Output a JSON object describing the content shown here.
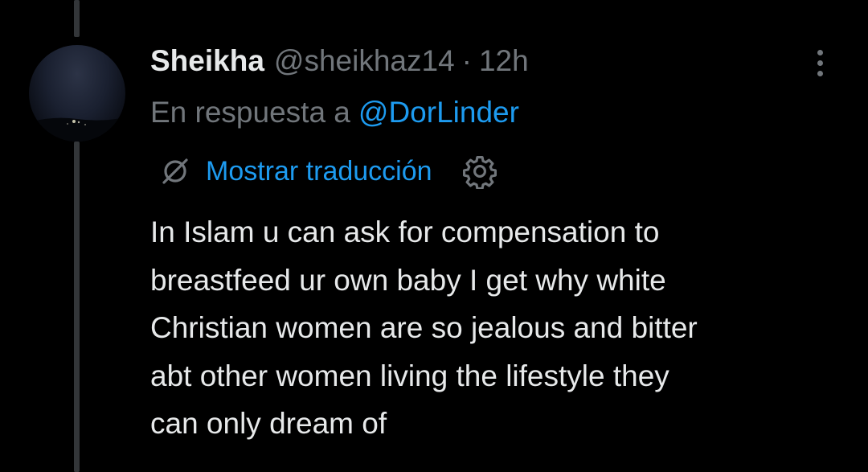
{
  "tweet": {
    "author_name": "Sheikha",
    "author_handle": "@sheikhaz14",
    "separator": "·",
    "timestamp": "12h",
    "reply_prefix": "En respuesta a",
    "reply_mention": "@DorLinder",
    "translate_label": "Mostrar traducción",
    "text_lines": [
      "In Islam u can ask for compensation to",
      "breastfeed ur own baby I get why white",
      "Christian women are so jealous and bitter",
      "abt other women living the lifestyle they",
      "can only dream of"
    ]
  },
  "icons": {
    "avatar": "avatar-night-sky-photo",
    "more": "more-vertical-icon",
    "translate": "translate-icon",
    "settings": "gear-icon"
  },
  "colors": {
    "background": "#000000",
    "primary_text": "#e7e9ea",
    "secondary_text": "#71767b",
    "accent_link": "#1d9bf0",
    "thread_line": "#333639"
  }
}
